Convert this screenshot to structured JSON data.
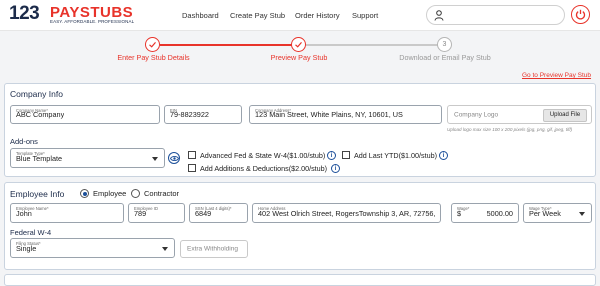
{
  "header": {
    "logo_number": "123",
    "logo_word": "PAYSTUBS",
    "logo_tagline": "EASY. AFFORDABLE. PROFESSIONAL",
    "nav": [
      "Dashboard",
      "Create Pay Stub",
      "Order History",
      "Support"
    ],
    "user_icon": "user-icon",
    "power_icon": "power-icon",
    "accent_color": "#e8332a",
    "brand_dark": "#1c2b4a"
  },
  "stepper": {
    "steps": [
      {
        "label": "Enter Pay Stub Details",
        "state": "done",
        "marker": "check-icon"
      },
      {
        "label": "Preview Pay Stub",
        "state": "done",
        "marker": "check-icon"
      },
      {
        "label": "Download or Email Pay Stub",
        "state": "pending",
        "marker": "3"
      }
    ],
    "preview_link": "Go to Preview Pay Stub"
  },
  "company": {
    "title": "Company Info",
    "name_label": "Company Name*",
    "name_value": "ABC Company",
    "ein_label": "EIN",
    "ein_value": "79-8823922",
    "address_label": "Company Address*",
    "address_value": "123 Main Street, White Plains, NY, 10601, US",
    "logo_placeholder": "Company Logo",
    "upload_label": "Upload File",
    "logo_hint": "Upload logo max size 100 x 200 pixels (jpg, png, gif, jpeg, tiff)"
  },
  "addons": {
    "title": "Add-ons",
    "template_label": "Template Type*",
    "template_value": "Blue Template",
    "options": [
      {
        "label": "Advanced Fed & State W-4($1.00/stub)",
        "checked": false
      },
      {
        "label": "Add Last YTD($1.00/stub)",
        "checked": false
      },
      {
        "label": "Add Additions & Deductions($2.00/stub)",
        "checked": false
      }
    ]
  },
  "employee": {
    "title": "Employee Info",
    "type_options": [
      {
        "label": "Employee",
        "selected": true
      },
      {
        "label": "Contractor",
        "selected": false
      }
    ],
    "name_label": "Employee Name*",
    "name_value": "John",
    "id_label": "Employee ID",
    "id_value": "789",
    "ssn_label": "SSN (Last 4 digits)*",
    "ssn_value": "6849",
    "address_label": "Home Address",
    "address_value": "402 West Olrich Street, RogersTownship 3, AR, 72756, US",
    "wage_label": "Wage*",
    "wage_currency": "$",
    "wage_value": "5000.00",
    "wage_type_label": "Wage Type*",
    "wage_type_value": "Per Week"
  },
  "federal_w4": {
    "title": "Federal W-4",
    "filing_label": "Filing Status*",
    "filing_value": "Single",
    "extra_placeholder": "Extra Withholding"
  }
}
